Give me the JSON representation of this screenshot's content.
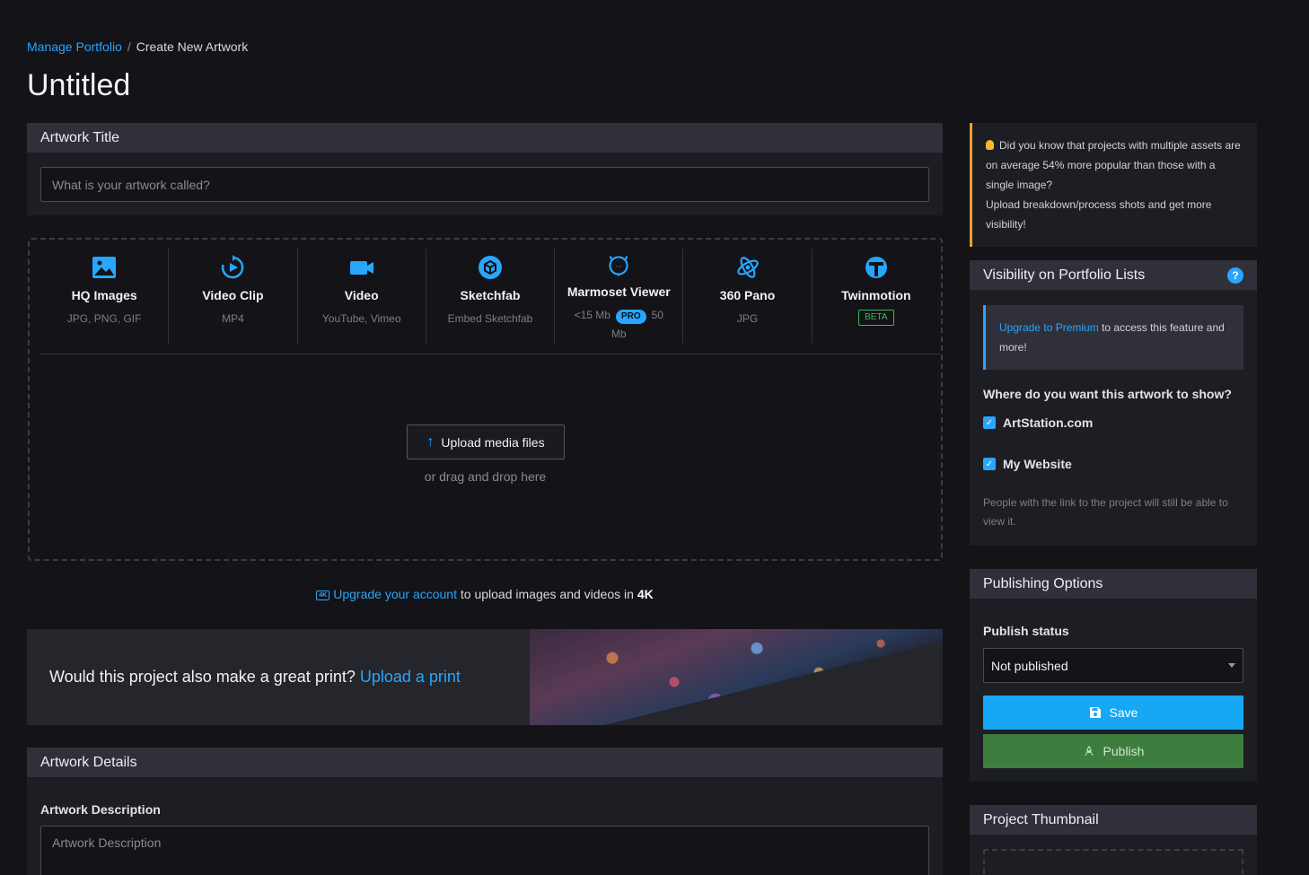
{
  "breadcrumb": {
    "root": "Manage Portfolio",
    "sep": "/",
    "current": "Create New Artwork"
  },
  "page_title": "Untitled",
  "artwork_title": {
    "heading": "Artwork Title",
    "placeholder": "What is your artwork called?"
  },
  "media_types": [
    {
      "name": "HQ Images",
      "sub": "JPG, PNG, GIF",
      "icon": "image-icon"
    },
    {
      "name": "Video Clip",
      "sub": "MP4",
      "icon": "video-clip-icon"
    },
    {
      "name": "Video",
      "sub": "YouTube, Vimeo",
      "icon": "video-camera-icon"
    },
    {
      "name": "Sketchfab",
      "sub": "Embed Sketchfab",
      "icon": "sketchfab-icon"
    },
    {
      "name": "Marmoset Viewer",
      "sub_pre": "<15 Mb",
      "badge": "PRO",
      "sub_post": "50",
      "sub_line2": "Mb",
      "icon": "marmoset-icon"
    },
    {
      "name": "360 Pano",
      "sub": "JPG",
      "icon": "pano-icon"
    },
    {
      "name": "Twinmotion",
      "badge": "BETA",
      "icon": "twinmotion-icon"
    }
  ],
  "upload": {
    "button_label": "Upload media files",
    "drag_text": "or drag and drop here"
  },
  "upgrade_4k": {
    "icon_text": "4K",
    "link": "Upgrade your account",
    "text": "to upload images and videos in",
    "bold": "4K"
  },
  "print_banner": {
    "text": "Would this project also make a great print?",
    "link": "Upload a print"
  },
  "artwork_details": {
    "heading": "Artwork Details",
    "desc_label": "Artwork Description",
    "desc_placeholder": "Artwork Description"
  },
  "tip": {
    "line1": "Did you know that projects with multiple assets are on average 54% more popular than those with a single image?",
    "line2": "Upload breakdown/process shots and get more visibility!"
  },
  "visibility": {
    "heading": "Visibility on Portfolio Lists",
    "help": "?",
    "premium_link": "Upgrade to Premium",
    "premium_text": "to access this feature and more!",
    "question": "Where do you want this artwork to show?",
    "options": [
      {
        "label": "ArtStation.com",
        "checked": true
      },
      {
        "label": "My Website",
        "checked": true
      }
    ],
    "note": "People with the link to the project will still be able to view it."
  },
  "publishing": {
    "heading": "Publishing Options",
    "status_label": "Publish status",
    "status_value": "Not published",
    "save_label": "Save",
    "publish_label": "Publish"
  },
  "thumbnail": {
    "heading": "Project Thumbnail"
  },
  "colors": {
    "accent": "#28a6ff",
    "tip_border": "#f0a030",
    "publish": "#3d7e3f",
    "beta": "#3fb950"
  }
}
